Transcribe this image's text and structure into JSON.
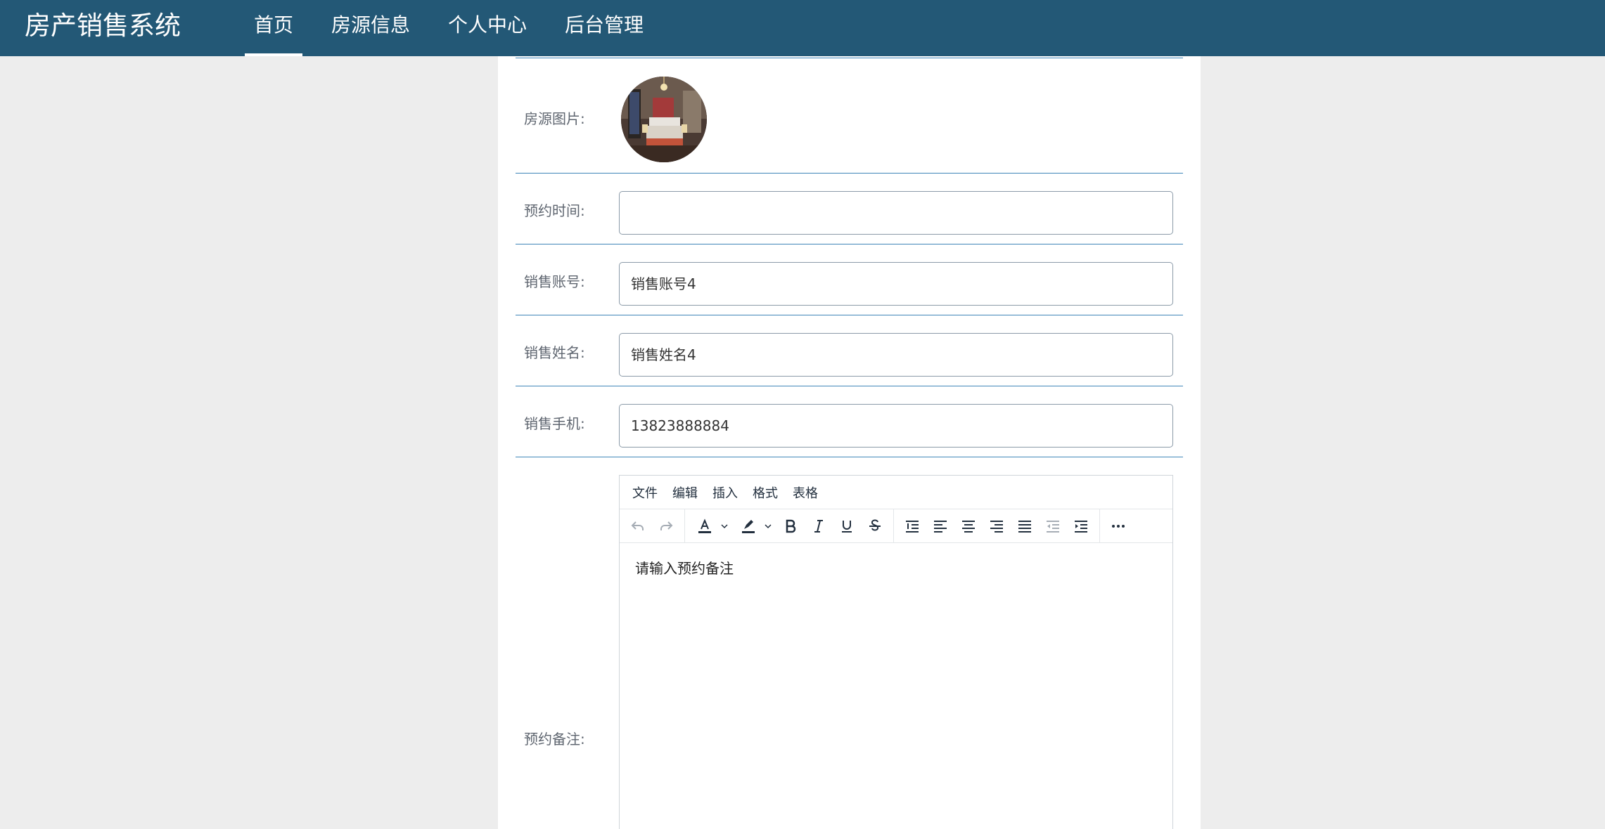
{
  "header": {
    "brand": "房产销售系统",
    "nav": [
      {
        "label": "首页",
        "active": true
      },
      {
        "label": "房源信息",
        "active": false
      },
      {
        "label": "个人中心",
        "active": false
      },
      {
        "label": "后台管理",
        "active": false
      }
    ]
  },
  "form": {
    "photo_label": "房源图片:",
    "appointment_time": {
      "label": "预约时间:",
      "value": ""
    },
    "sales_account": {
      "label": "销售账号:",
      "value": "销售账号4"
    },
    "sales_name": {
      "label": "销售姓名:",
      "value": "销售姓名4"
    },
    "sales_phone": {
      "label": "销售手机:",
      "value": "13823888884"
    },
    "remark": {
      "label": "预约备注:",
      "placeholder": "请输入预约备注"
    }
  },
  "editor": {
    "menus": [
      "文件",
      "编辑",
      "插入",
      "格式",
      "表格"
    ],
    "toolbar_icons": [
      "undo-icon",
      "redo-icon",
      "text-color-icon",
      "highlight-color-icon",
      "bold-icon",
      "italic-icon",
      "underline-icon",
      "strikethrough-icon",
      "line-height-icon",
      "align-left-icon",
      "align-center-icon",
      "align-right-icon",
      "align-justify-icon",
      "outdent-icon",
      "indent-icon",
      "more-icon"
    ]
  },
  "colors": {
    "header_bg": "#235876",
    "row_divider": "#3e85b8",
    "page_bg": "#ededed"
  }
}
